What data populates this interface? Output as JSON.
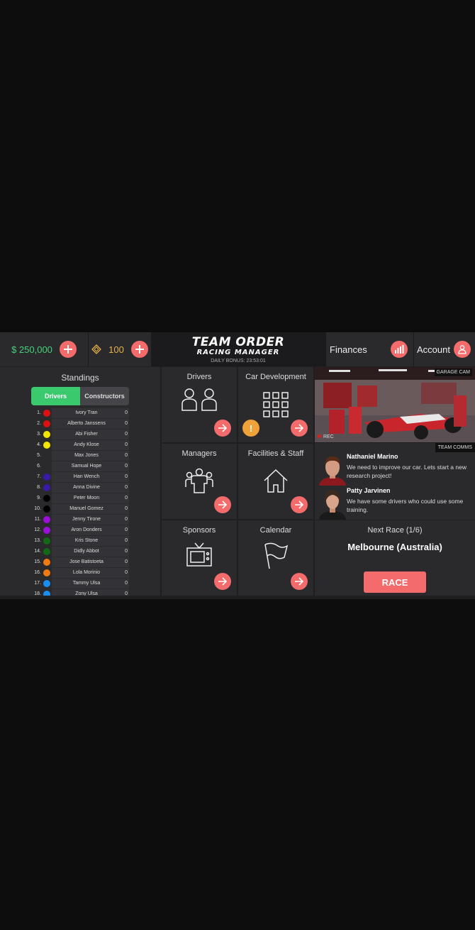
{
  "topbar": {
    "money": "$ 250,000",
    "gems": "100",
    "logo_title": "TEAM ORDER",
    "logo_subtitle": "RACING MANAGER",
    "daily_bonus": "DAILY BONUS: 23:53:01",
    "finances_label": "Finances",
    "account_label": "Account"
  },
  "standings": {
    "title": "Standings",
    "tab_drivers": "Drivers",
    "tab_constructors": "Constructors",
    "rows": [
      {
        "pos": "1.",
        "name": "Ivory Tran",
        "points": "0",
        "color": "#e01010"
      },
      {
        "pos": "2.",
        "name": "Alberto Janssens",
        "points": "0",
        "color": "#e01010"
      },
      {
        "pos": "3.",
        "name": "Abi Fisher",
        "points": "0",
        "color": "#f2e600"
      },
      {
        "pos": "4.",
        "name": "Andy Klose",
        "points": "0",
        "color": "#f2e600"
      },
      {
        "pos": "5.",
        "name": "Max Jones",
        "points": "0",
        "color": "#2a2a2d"
      },
      {
        "pos": "6.",
        "name": "Samual Hope",
        "points": "0",
        "color": "#2a2a2d"
      },
      {
        "pos": "7.",
        "name": "Han Wench",
        "points": "0",
        "color": "#3a1aa8"
      },
      {
        "pos": "8.",
        "name": "Anna Divine",
        "points": "0",
        "color": "#3a1aa8"
      },
      {
        "pos": "9.",
        "name": "Peter Moon",
        "points": "0",
        "color": "#000000"
      },
      {
        "pos": "10.",
        "name": "Manuel Gomez",
        "points": "0",
        "color": "#000000"
      },
      {
        "pos": "11.",
        "name": "Jenny Tirone",
        "points": "0",
        "color": "#9b10d8"
      },
      {
        "pos": "12.",
        "name": "Aron Donders",
        "points": "0",
        "color": "#9b10d8"
      },
      {
        "pos": "13.",
        "name": "Kris Stone",
        "points": "0",
        "color": "#0f6a12"
      },
      {
        "pos": "14.",
        "name": "Didly Abbot",
        "points": "0",
        "color": "#0f6a12"
      },
      {
        "pos": "15.",
        "name": "Jose Batistoeta",
        "points": "0",
        "color": "#f07a10"
      },
      {
        "pos": "16.",
        "name": "Lola Morinio",
        "points": "0",
        "color": "#f07a10"
      },
      {
        "pos": "17.",
        "name": "Tammy Ulsa",
        "points": "0",
        "color": "#1a8ef0"
      },
      {
        "pos": "18.",
        "name": "Zony Ulsa",
        "points": "0",
        "color": "#1a8ef0"
      }
    ]
  },
  "tiles": {
    "drivers": "Drivers",
    "car_development": "Car Development",
    "car_dev_alert": "!",
    "managers": "Managers",
    "facilities": "Facilities & Staff",
    "sponsors": "Sponsors",
    "calendar": "Calendar"
  },
  "garage": {
    "tag": "GARAGE CAM",
    "rec": "REC"
  },
  "comms": {
    "tag": "TEAM COMMS",
    "messages": [
      {
        "name": "Nathaniel Marino",
        "text": "We need to improve our car. Lets start a new research project!"
      },
      {
        "name": "Patty Jarvinen",
        "text": "We have some drivers who could use some training."
      }
    ]
  },
  "next_race": {
    "title": "Next Race (1/6)",
    "circuit": "Melbourne (Australia)",
    "button": "RACE"
  },
  "colors": {
    "accent": "#f36b6b",
    "money": "#47d17a",
    "gems": "#e3b34a",
    "tab_active": "#3bc96e",
    "alert": "#f0a23a"
  }
}
